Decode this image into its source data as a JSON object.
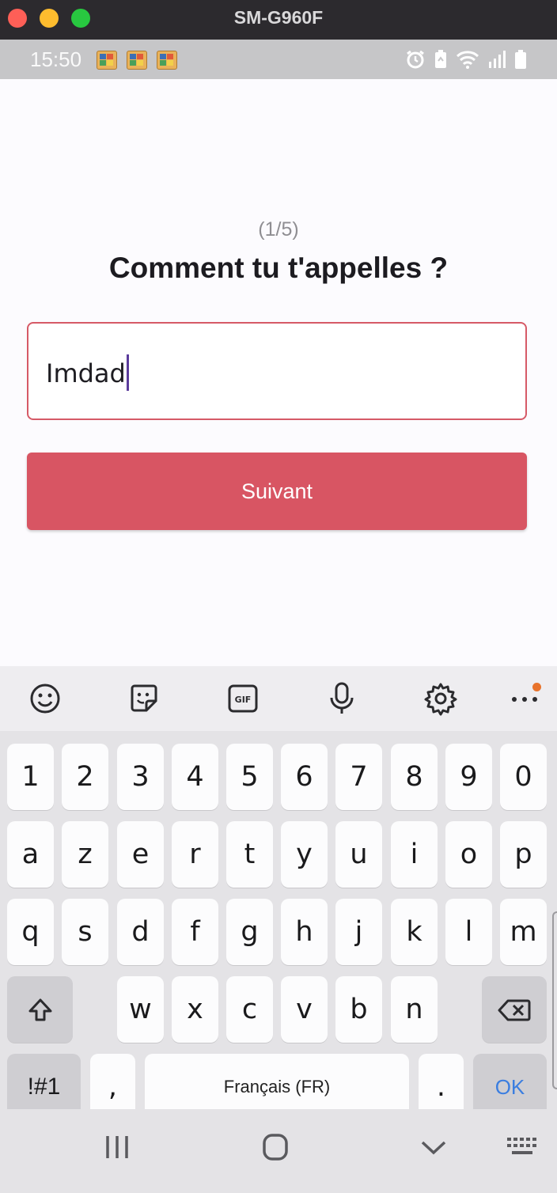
{
  "window": {
    "title": "SM-G960F"
  },
  "status_bar": {
    "time": "15:50",
    "notification_icons": [
      "puzzle-notification-icon",
      "puzzle-notification-icon",
      "puzzle-notification-icon"
    ],
    "system_icons": [
      "alarm-icon",
      "battery-saver-icon",
      "wifi-icon",
      "signal-icon",
      "battery-icon"
    ]
  },
  "onboarding": {
    "step": "(1/5)",
    "question": "Comment tu t'appelles ?",
    "name_value": "Imdad",
    "next_label": "Suivant",
    "accent_color": "#d85563"
  },
  "keyboard": {
    "toolbar": [
      "emoji-icon",
      "sticker-icon",
      "gif-icon",
      "microphone-icon",
      "settings-icon",
      "more-icon"
    ],
    "rows": [
      [
        "1",
        "2",
        "3",
        "4",
        "5",
        "6",
        "7",
        "8",
        "9",
        "0"
      ],
      [
        "a",
        "z",
        "e",
        "r",
        "t",
        "y",
        "u",
        "i",
        "o",
        "p"
      ],
      [
        "q",
        "s",
        "d",
        "f",
        "g",
        "h",
        "j",
        "k",
        "l",
        "m"
      ],
      [
        "w",
        "x",
        "c",
        "v",
        "b",
        "n"
      ]
    ],
    "symbols_label": "!#1",
    "comma_label": ",",
    "space_label": "Français (FR)",
    "period_label": ".",
    "ok_label": "OK"
  },
  "navigation": [
    "recent-apps-icon",
    "home-icon",
    "back-icon",
    "keyboard-switch-icon"
  ]
}
